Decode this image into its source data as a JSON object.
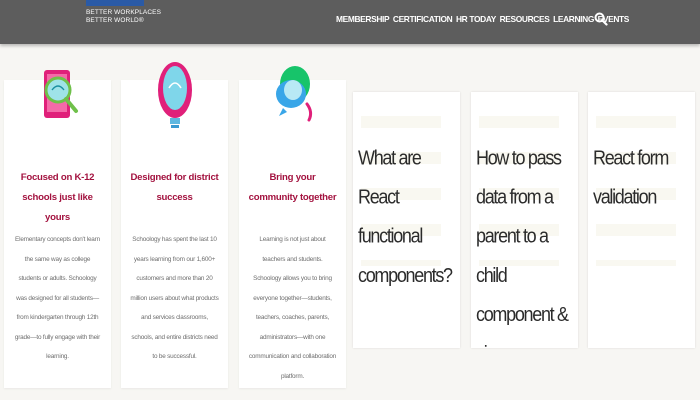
{
  "header": {
    "logo_tagline": "BETTER WORKPLACES\nBETTER WORLD®",
    "nav": [
      "MEMBERSHIP",
      "CERTIFICATION",
      "HR TODAY",
      "RESOURCES",
      "LEARNING",
      "EVENTS"
    ],
    "search_icon": "search-icon"
  },
  "features": [
    {
      "icon": "tablet-magnifier-illustration",
      "title": "Focused on K-12 schools just like yours",
      "body": "Elementary concepts don't learn the same way as college students or adults. Schoology was designed for all students—from kindergarten through 12th grade—to fully engage with their learning."
    },
    {
      "icon": "lightbulb-illustration",
      "title": "Designed for district success",
      "body": "Schoology has spent the last 10 years learning from our 1,600+ customers and more than 20 million users about what products and services classrooms, schools, and entire districts need to be successful."
    },
    {
      "icon": "chat-bubbles-illustration",
      "title": "Bring your community together",
      "body": "Learning is not just about teachers and students. Schoology allows you to bring everyone together—students, teachers, coaches, parents, administrators—with one communication and collaboration platform."
    }
  ],
  "articles": [
    {
      "title": "What are React functional components?"
    },
    {
      "title": "How to pass data from a parent to a child component & vice versa"
    },
    {
      "title": "React form validation"
    }
  ],
  "colors": {
    "header_bg": "#5d5d5d",
    "feature_title": "#a3123f",
    "page_bg": "#f7f6f3"
  }
}
